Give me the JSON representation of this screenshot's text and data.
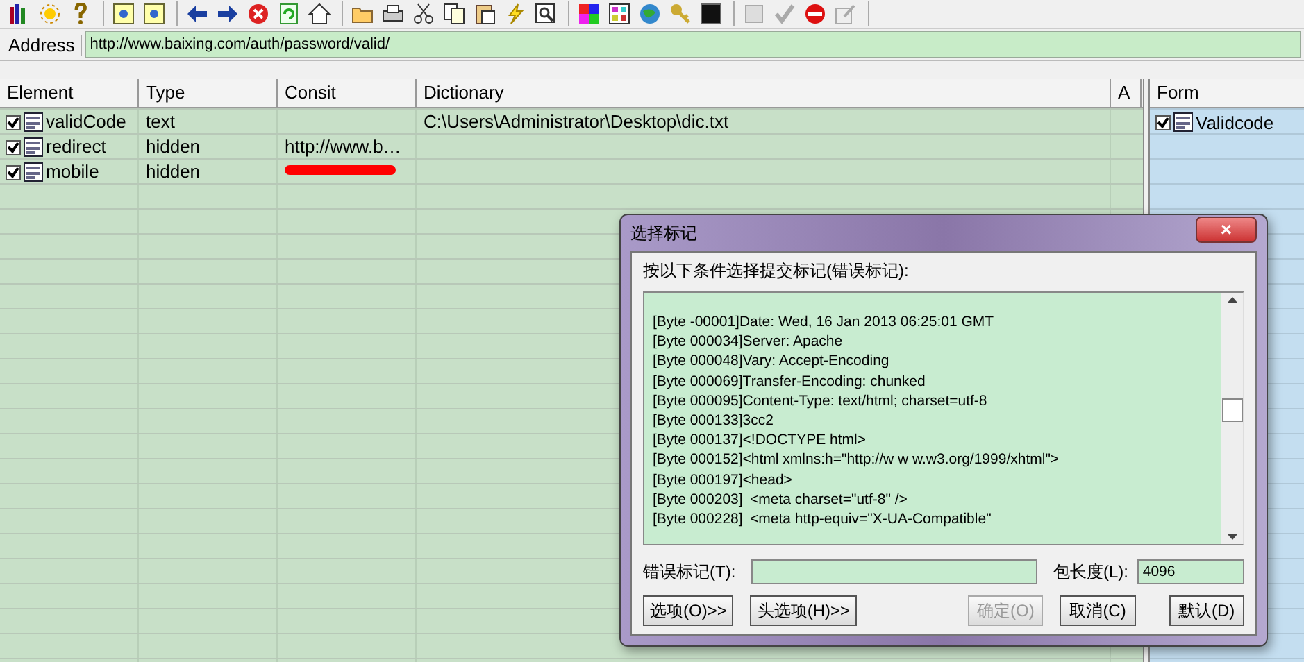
{
  "address_bar": {
    "label": "Address",
    "value": "http://www.baixing.com/auth/password/valid/"
  },
  "table": {
    "columns": [
      "Element",
      "Type",
      "Consit",
      "Dictionary",
      "A"
    ],
    "rows": [
      {
        "checked": true,
        "cells": [
          "validCode",
          "text",
          "",
          "C:\\Users\\Administrator\\Desktop\\dic.txt",
          ""
        ],
        "redacted": false
      },
      {
        "checked": true,
        "cells": [
          "redirect",
          "hidden",
          "http://www.b…",
          "",
          ""
        ],
        "redacted": false
      },
      {
        "checked": true,
        "cells": [
          "mobile",
          "hidden",
          "",
          "",
          ""
        ],
        "redacted": true
      }
    ]
  },
  "form_panel": {
    "heading": "Form",
    "items": [
      {
        "label": "Validcode",
        "checked": true
      }
    ]
  },
  "dialog": {
    "title": "选择标记",
    "close": "×",
    "prompt": "按以下条件选择提交标记(错误标记):",
    "log_lines": [
      "[Byte -00001]Date: Wed, 16 Jan 2013 06:25:01 GMT",
      "[Byte 000034]Server: Apache",
      "[Byte 000048]Vary: Accept-Encoding",
      "[Byte 000069]Transfer-Encoding: chunked",
      "[Byte 000095]Content-Type: text/html; charset=utf-8",
      "[Byte 000133]3cc2",
      "[Byte 000137]<!DOCTYPE html>",
      "[Byte 000152]<html xmlns:h=\"http://w w w.w3.org/1999/xhtml\">",
      "[Byte 000197]<head>",
      "[Byte 000203]\t<meta charset=\"utf-8\" />",
      "[Byte 000228]\t<meta http-equiv=\"X-UA-Compatible\""
    ],
    "error_mark": {
      "label": "错误标记(T):"
    },
    "packet_length": {
      "label": "包长度(L):",
      "value": "4096"
    },
    "buttons": [
      {
        "label": "选项(O)>>",
        "disabled": false
      },
      {
        "label": "头选项(H)>>",
        "disabled": false
      },
      {
        "label": "确定(O)",
        "disabled": true
      },
      {
        "label": "取消(C)",
        "disabled": false
      },
      {
        "label": "默认(D)",
        "disabled": false
      }
    ]
  }
}
